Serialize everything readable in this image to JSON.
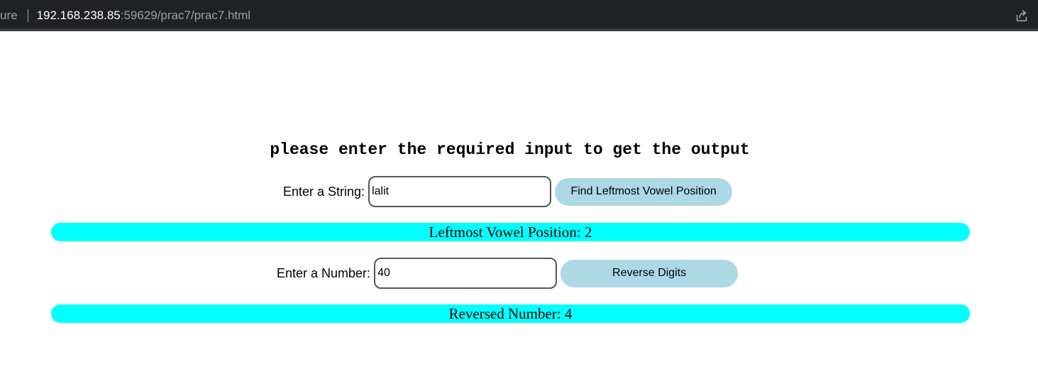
{
  "browser": {
    "security_label": "ure",
    "url_host": "192.168.238.85",
    "url_rest": ":59629/prac7/prac7.html"
  },
  "page": {
    "heading": "please enter the required input to get the output"
  },
  "string_form": {
    "label": "Enter a String:",
    "value": "lalit",
    "button_label": "Find Leftmost Vowel Position",
    "result": "Leftmost Vowel Position: 2"
  },
  "number_form": {
    "label": "Enter a Number:",
    "value": "40",
    "button_label": "Reverse Digits",
    "result": "Reversed Number: 4"
  },
  "colors": {
    "result_background": "#00ffff",
    "button_background": "#add8e6",
    "browser_bar": "#202124"
  },
  "icons": {
    "share": "share-icon"
  }
}
